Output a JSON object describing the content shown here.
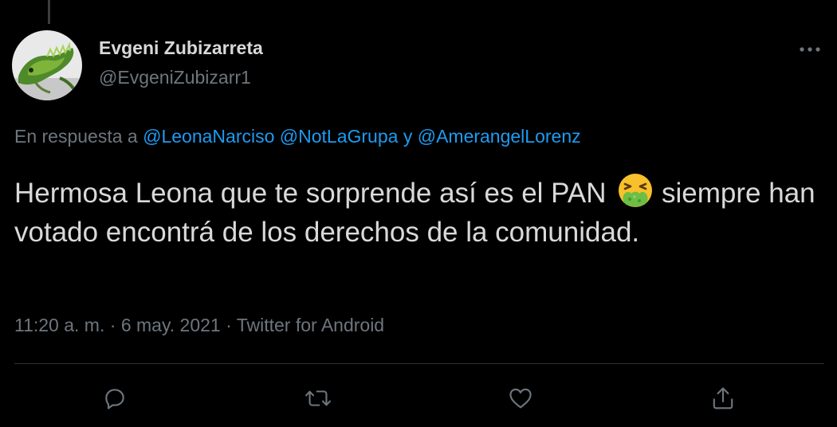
{
  "tweet": {
    "author_name": "Evgeni Zubizarreta",
    "author_handle": "@EvgeniZubizarr1",
    "avatar_icon": "iguana-avatar",
    "reply_prefix": "En respuesta a ",
    "mentions": [
      "@LeonaNarciso",
      "@NotLaGrupa",
      "@AmerangelLorenz"
    ],
    "mention_joiner_1": " ",
    "mention_joiner_2": " y ",
    "text_before_emoji": "Hermosa Leona que te sorprende así es el PAN",
    "emoji_icon": "vomiting-face-emoji",
    "text_after_emoji": "siempre han votado encontrá de los derechos de la comunidad.",
    "time": "11:20 a. m.",
    "separator": " · ",
    "date": "6 may. 2021",
    "source": "Twitter for Android"
  },
  "actions": {
    "reply_icon": "reply-icon",
    "retweet_icon": "retweet-icon",
    "like_icon": "heart-icon",
    "share_icon": "share-icon",
    "more_icon": "more-icon"
  },
  "colors": {
    "background": "#000000",
    "text": "#d9d9d9",
    "secondary": "#6e767d",
    "link": "#1d9bf0",
    "divider": "#2f3336"
  }
}
